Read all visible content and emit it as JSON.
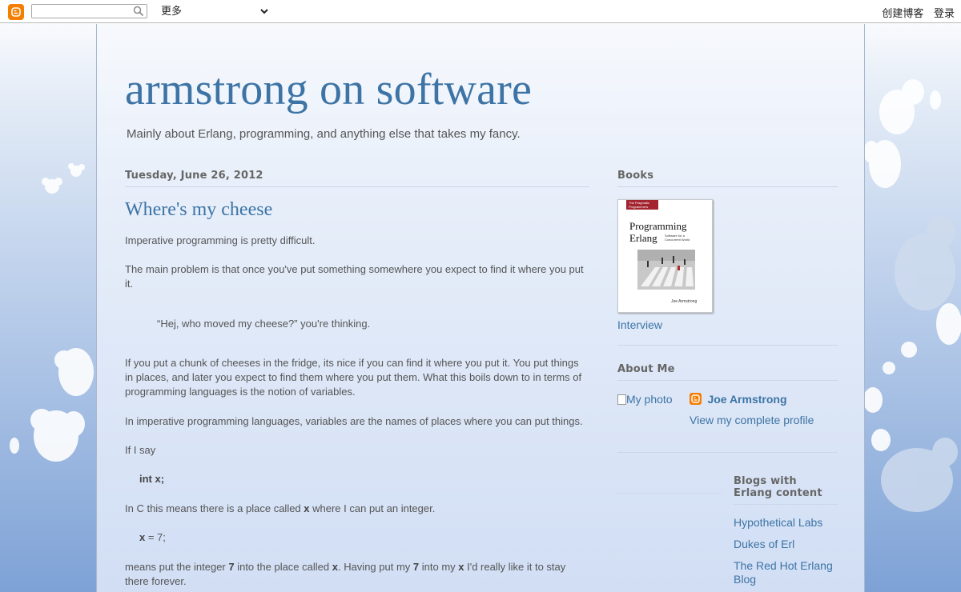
{
  "navbar": {
    "search_placeholder": "",
    "more_label": "更多",
    "create_blog": "创建博客",
    "sign_in": "登录"
  },
  "header": {
    "title": "armstrong on software",
    "description": "Mainly about Erlang, programming, and anything else that takes my fancy."
  },
  "post": {
    "date": "Tuesday, June 26, 2012",
    "title": "Where's my cheese",
    "p1": "Imperative programming is pretty difficult.",
    "p2": "The main problem is that once you've put something somewhere you expect to find it where you put it.",
    "quote": "“Hej, who moved my cheese?” you're thinking.",
    "p3": "If you put a chunk of cheeses in the fridge, its nice if you can find it where you put it.  You put things in places, and later you expect to find them where you put them.  What this boils down to in terms of programming languages is the notion of variables.",
    "p4": "In imperative programming languages, variables are the names of places where you can put things.",
    "p5": "If I say",
    "code1": "int x;",
    "p6_pre": "In C this means there is a place called ",
    "p6_var": "x",
    "p6_post": " where I can put an integer.",
    "code2_var": "x",
    "code2_rest": " = 7;",
    "p7_a": "means put the integer ",
    "p7_b": "7",
    "p7_c": " into the place called ",
    "p7_d": "x",
    "p7_e": ". Having put my ",
    "p7_f": "7",
    "p7_g": " into my ",
    "p7_h": "x",
    "p7_i": " I'd really like it to stay there forever."
  },
  "sidebar": {
    "books_title": "Books",
    "book": {
      "publisher": "The Pragmatic Programmers",
      "title_line1": "Programming",
      "title_line2": "Erlang",
      "subtitle": "Software for a Concurrent World",
      "author": "Joe Armstrong"
    },
    "interview_link": "Interview",
    "about_title": "About Me",
    "photo_alt": "My photo",
    "author_name": "Joe Armstrong",
    "profile_link": "View my complete profile",
    "blogs_title": "Blogs with Erlang content",
    "blogs": [
      "Hypothetical Labs",
      "Dukes of Erl",
      "The Red Hot Erlang Blog"
    ]
  },
  "colors": {
    "link": "#3d74a5",
    "blogger_orange": "#f57d00"
  }
}
